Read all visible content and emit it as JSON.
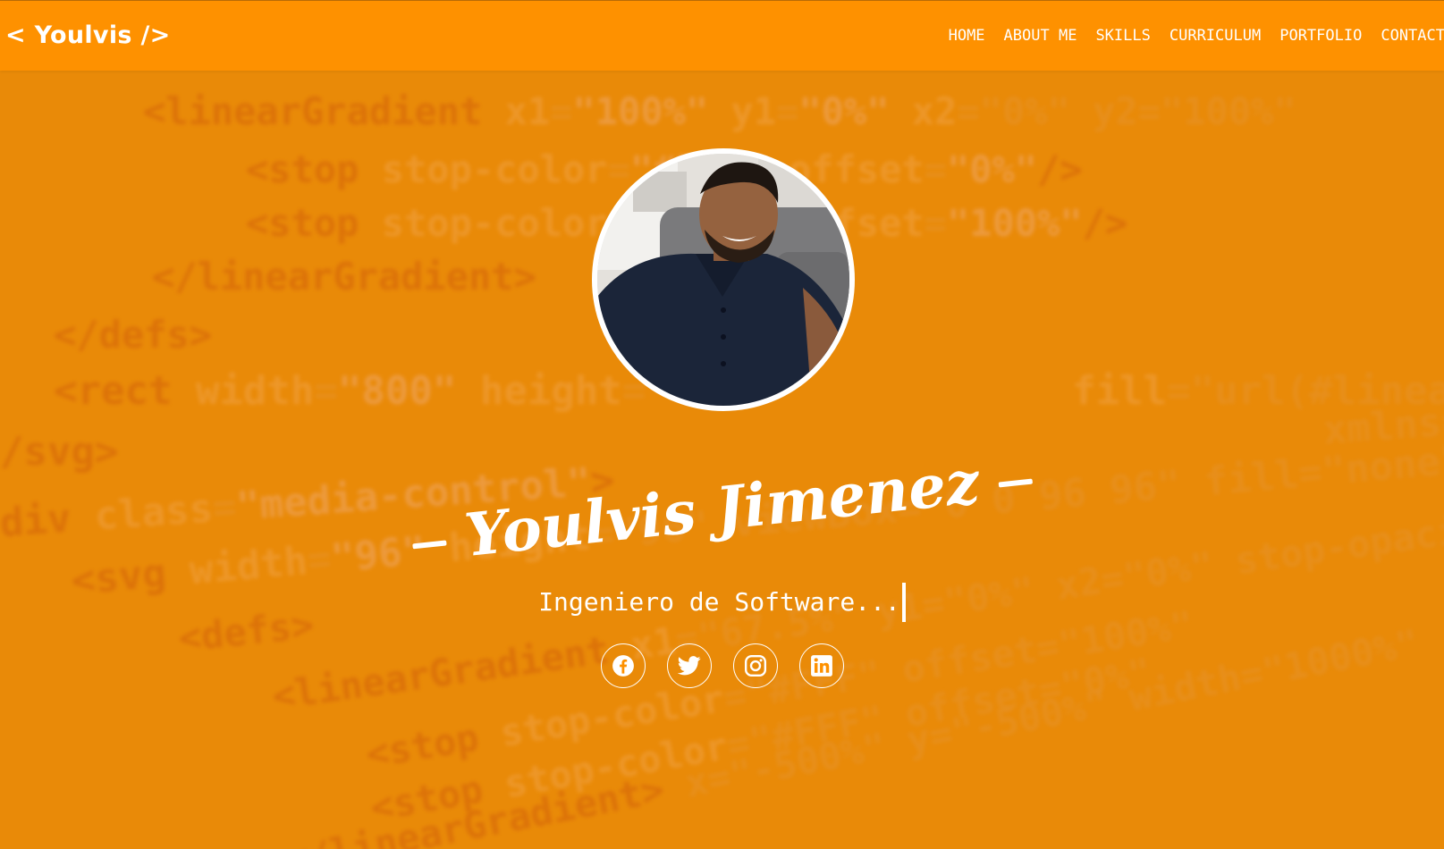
{
  "brand": {
    "logo_text": "< Youlvis />"
  },
  "nav": {
    "items": [
      {
        "label": "HOME"
      },
      {
        "label": "ABOUT ME"
      },
      {
        "label": "SKILLS"
      },
      {
        "label": "CURRICULUM"
      },
      {
        "label": "PORTFOLIO"
      },
      {
        "label": "CONTACT"
      }
    ]
  },
  "hero": {
    "name": "Youlvis Jimenez",
    "subtitle": "Ingeniero de Software..."
  },
  "social": [
    {
      "icon": "facebook-icon"
    },
    {
      "icon": "twitter-icon"
    },
    {
      "icon": "instagram-icon"
    },
    {
      "icon": "linkedin-icon"
    }
  ],
  "colors": {
    "navbar": "#fe9100",
    "background": "#e98a08",
    "text": "#ffffff"
  }
}
